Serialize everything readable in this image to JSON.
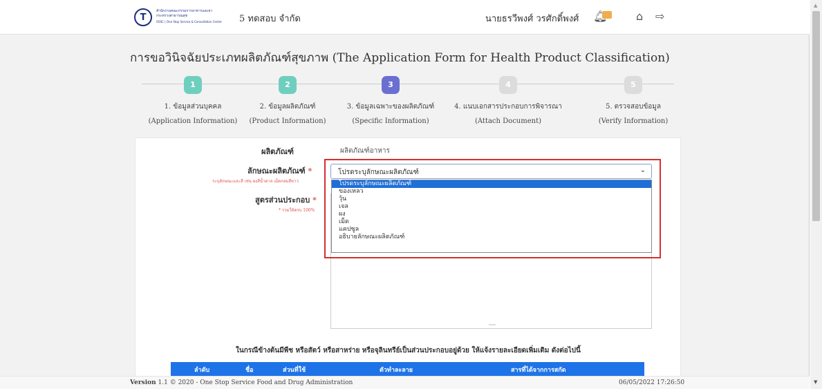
{
  "header": {
    "logo": {
      "mark": "T",
      "line1": "สำนักงานคณะกรรมการอาหารและยา",
      "line2": "กระทรวงสาธารณสุข",
      "line3": "OSSC | One Stop Service & Consultation Center"
    },
    "company": "5 ทดสอบ จำกัด",
    "user": "นายธรวีพงศ์ วรศักดิ์พงศ์",
    "icons": [
      "bell-icon",
      "home-icon",
      "logout-icon"
    ],
    "notification_badge": "",
    "accent_color": "#f0ad4e"
  },
  "page_title": "การขอวินิจฉัยประเภทผลิตภัณฑ์สุขภาพ (The Application Form for Health Product Classification)",
  "steps": [
    {
      "num": "1",
      "th": "1. ข้อมูลส่วนบุคคล",
      "en": "(Application Information)",
      "color": "#6fcfbf"
    },
    {
      "num": "2",
      "th": "2. ข้อมูลผลิตภัณฑ์",
      "en": "(Product Information)",
      "color": "#6fcfbf"
    },
    {
      "num": "3",
      "th": "3. ข้อมูลเฉพาะของผลิตภัณฑ์",
      "en": "(Specific Information)",
      "color": "#6a6fd1"
    },
    {
      "num": "4",
      "th": "4. แนบเอกสารประกอบการพิจารณา",
      "en": "(Attach Document)",
      "color": "#dcdcdc"
    },
    {
      "num": "5",
      "th": "5. ตรวจสอบข้อมูล",
      "en": "(Verify Information)",
      "color": "#dcdcdc"
    }
  ],
  "form": {
    "product_label": "ผลิตภัณฑ์",
    "product_value": "ผลิตภัณฑ์อาหาร",
    "characteristic_label": "ลักษณะผลิตภัณฑ์",
    "characteristic_hint": "ระบุลักษณะและสี เช่น ผงสีน้ำตาล เม็ดกลมสีขาว",
    "required_mark": "*",
    "select_value": "โปรดระบุลักษณะผลิตภัณฑ์",
    "options": [
      "โปรดระบุลักษณะผลิตภัณฑ์",
      "ของเหลว",
      "วุ้น",
      "เจล",
      "ผง",
      "เม็ด",
      "แคปซูล",
      "อธิบายลักษณะผลิตภัณฑ์"
    ],
    "selected_index": 0,
    "formula_label": "สูตรส่วนประกอบ",
    "formula_hint": "* รวมให้ครบ 100%"
  },
  "note": "ในกรณีข้างต้นมีพืช หรือสัตว์ หรือสาหร่าย หรือจุลินทรีย์เป็นส่วนประกอบอยู่ด้วย ให้แจ้งรายละเอียดเพิ่มเติม ดังต่อไปนี้",
  "table": {
    "headers": [
      "ลำดับ",
      "ชื่อ",
      "ส่วนที่ใช้",
      "ตัวทำละลาย",
      "สารที่ได้จากการสกัด"
    ],
    "color": "#1e73e8"
  },
  "footer": {
    "version_bold": "Version",
    "version_text": " 1.1 © 2020 - One Stop Service Food and Drug Administration",
    "timestamp": "06/05/2022 17:26:50"
  }
}
